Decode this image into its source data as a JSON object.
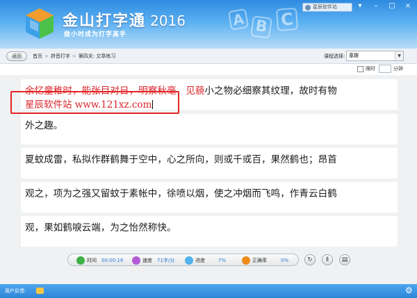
{
  "app": {
    "title": "金山打字通",
    "year": "2016",
    "slogan": "做小时成为打字高手",
    "user_label": "星辰软件站",
    "deco_letters": [
      "A",
      "B",
      "C"
    ]
  },
  "window_controls": [
    "▾",
    "–",
    "□",
    "×"
  ],
  "breadcrumb": {
    "back_label": "返回",
    "items": [
      "首页",
      "拼音打字",
      "第四关: 文章练习"
    ],
    "separator": ">"
  },
  "course": {
    "label": "课程选择:",
    "selected": "童趣"
  },
  "timer": {
    "label": "限时",
    "unit": "分钟",
    "checked": false
  },
  "practice": {
    "lines": [
      {
        "typed_part": "余忆童稚时，能张目对日，明察秋毫，见藐",
        "remaining_part": "小之物必细察其纹理，故时有物",
        "input": "星辰软件站 www.121xz.com"
      },
      {
        "typed_part": "",
        "remaining_part": "外之趣。",
        "input": ""
      },
      {
        "typed_part": "",
        "remaining_part": "夏蚊成雷，私拟作群鹤舞于空中，心之所向，则或千或百，果然鹤也；昂首",
        "input": ""
      },
      {
        "typed_part": "",
        "remaining_part": "观之，项为之强又留蚊于素帐中，徐喷以烟，使之冲烟而飞鸣，作青云白鹤",
        "input": ""
      },
      {
        "typed_part": "",
        "remaining_part": "观，果如鹤唳云端，为之怡然称快。",
        "input": ""
      }
    ]
  },
  "stats": {
    "time_label": "时间",
    "time_value": "00:00:16",
    "speed_label": "速度",
    "speed_value": "71字/分",
    "progress_label": "进度",
    "progress_value": "7%",
    "accuracy_label": "正确率",
    "accuracy_value": "0%"
  },
  "controls": {
    "restart": "↻",
    "pause": "Ⅱ",
    "test": "▤"
  },
  "footer": {
    "feedback_label": "用户反馈:",
    "settings_icon": "⚙"
  },
  "colors": {
    "typed_text": "#d9262b",
    "header_blue": "#2f8be0",
    "highlight_box": "#e52424"
  }
}
